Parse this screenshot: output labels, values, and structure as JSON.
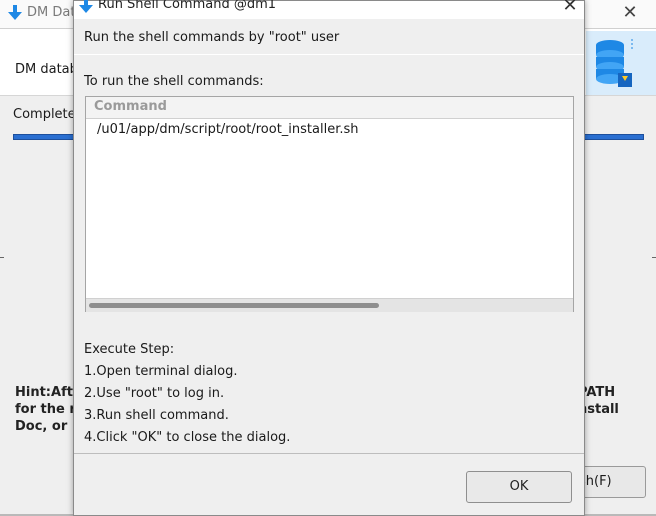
{
  "background_window": {
    "title": "DM Dat",
    "header_title": "DM datab",
    "status": "Complete",
    "progress": 1.0,
    "hint_lines": [
      "Hint:Aft",
      "for the r",
      "Doc, or"
    ],
    "hint_right_lines": [
      "PATH",
      "nstall"
    ],
    "finish_button_label": "sh(F)",
    "close_glyph": "✕",
    "accent_color": "#2a6fd1"
  },
  "dialog": {
    "title": "Run Shell Command @dm1",
    "close_glyph": "✕",
    "subtitle": "Run the shell commands by \"root\" user",
    "instructions_label": "To run the shell commands:",
    "table": {
      "columns": [
        "Command"
      ],
      "rows": [
        [
          "/u01/app/dm/script/root/root_installer.sh"
        ]
      ]
    },
    "steps_title": "Execute Step:",
    "steps": [
      "1.Open terminal dialog.",
      "2.Use \"root\" to log in.",
      "3.Run shell command.",
      "4.Click \"OK\" to close the dialog."
    ],
    "ok_label": "OK"
  },
  "icons": {
    "title_icon": "download-arrow-icon",
    "logo": "database-logo-icon"
  }
}
